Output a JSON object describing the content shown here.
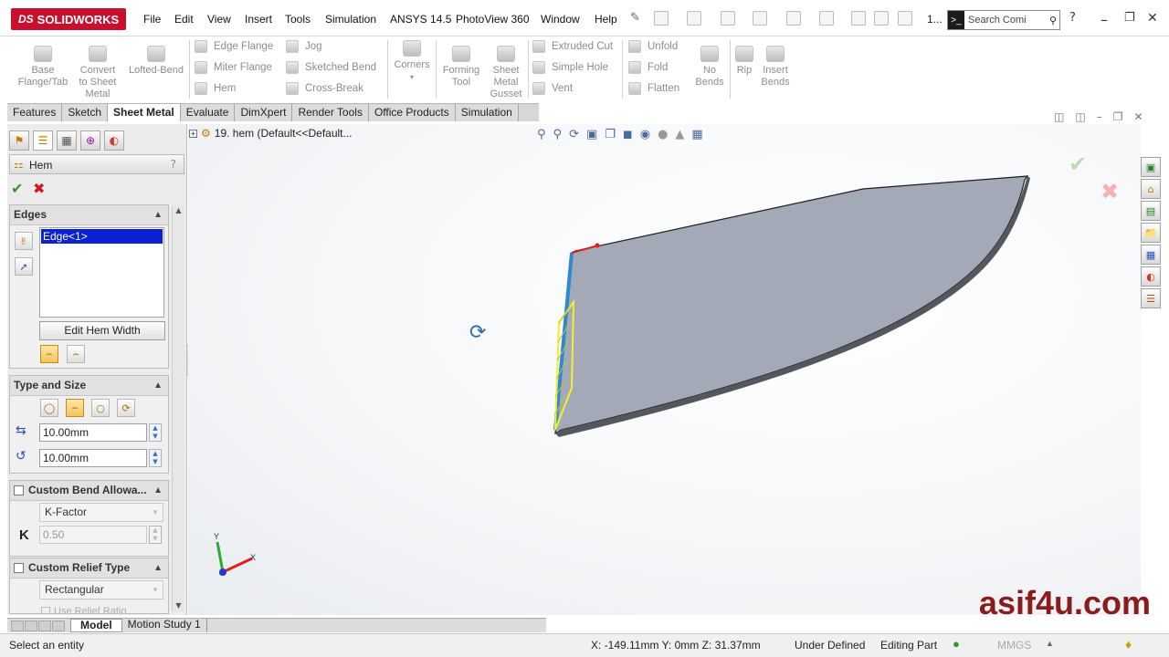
{
  "app": {
    "logo_prefix": "DS",
    "logo_name": "SOLIDWORKS"
  },
  "menu": [
    "File",
    "Edit",
    "View",
    "Insert",
    "Tools",
    "Simulation",
    "ANSYS 14.5",
    "PhotoView 360",
    "Window",
    "Help"
  ],
  "quick": {
    "page_indicator": "1...",
    "search_placeholder": "Search Comi"
  },
  "ribbon": {
    "base_flange": "Base\nFlange/Tab",
    "convert": "Convert\nto Sheet\nMetal",
    "lofted_bend": "Lofted-Bend",
    "edge_flange": "Edge Flange",
    "miter_flange": "Miter Flange",
    "hem": "Hem",
    "jog": "Jog",
    "sketched_bend": "Sketched Bend",
    "cross_break": "Cross-Break",
    "corners": "Corners",
    "forming_tool": "Forming\nTool",
    "gusset": "Sheet\nMetal\nGusset",
    "extruded_cut": "Extruded Cut",
    "simple_hole": "Simple Hole",
    "vent": "Vent",
    "unfold": "Unfold",
    "fold": "Fold",
    "flatten": "Flatten",
    "no_bends": "No\nBends",
    "rip": "Rip",
    "insert_bends": "Insert\nBends"
  },
  "tabs": [
    "Features",
    "Sketch",
    "Sheet Metal",
    "Evaluate",
    "DimXpert",
    "Render Tools",
    "Office Products",
    "Simulation"
  ],
  "active_tab": "Sheet Metal",
  "property_manager": {
    "title": "Hem",
    "help": "?",
    "edges": {
      "title": "Edges",
      "selection": "Edge<1>",
      "edit_button": "Edit Hem Width"
    },
    "type_size": {
      "title": "Type and Size",
      "length": "10.00mm",
      "gap": "10.00mm"
    },
    "custom_bend": {
      "title": "Custom Bend Allowa...",
      "type": "K-Factor",
      "k_label": "K",
      "k_value": "0.50"
    },
    "custom_relief": {
      "title": "Custom Relief Type",
      "type": "Rectangular",
      "ratio": "Use Relief Ratio"
    }
  },
  "tree": {
    "item": "19. hem  (Default<<Default..."
  },
  "triad": {
    "x": "X",
    "y": "Y"
  },
  "bottom_tabs": [
    "Model",
    "Motion Study 1"
  ],
  "status": {
    "message": "Select an entity",
    "coords": "X: -149.11mm Y: 0mm Z: 31.37mm",
    "state": "Under Defined",
    "mode": "Editing Part",
    "units": "MMGS"
  },
  "watermark": "asif4u.com",
  "colors": {
    "accent_red": "#c8102e",
    "selection_blue": "#0a22d4",
    "part_fill": "#a3a9b7"
  }
}
